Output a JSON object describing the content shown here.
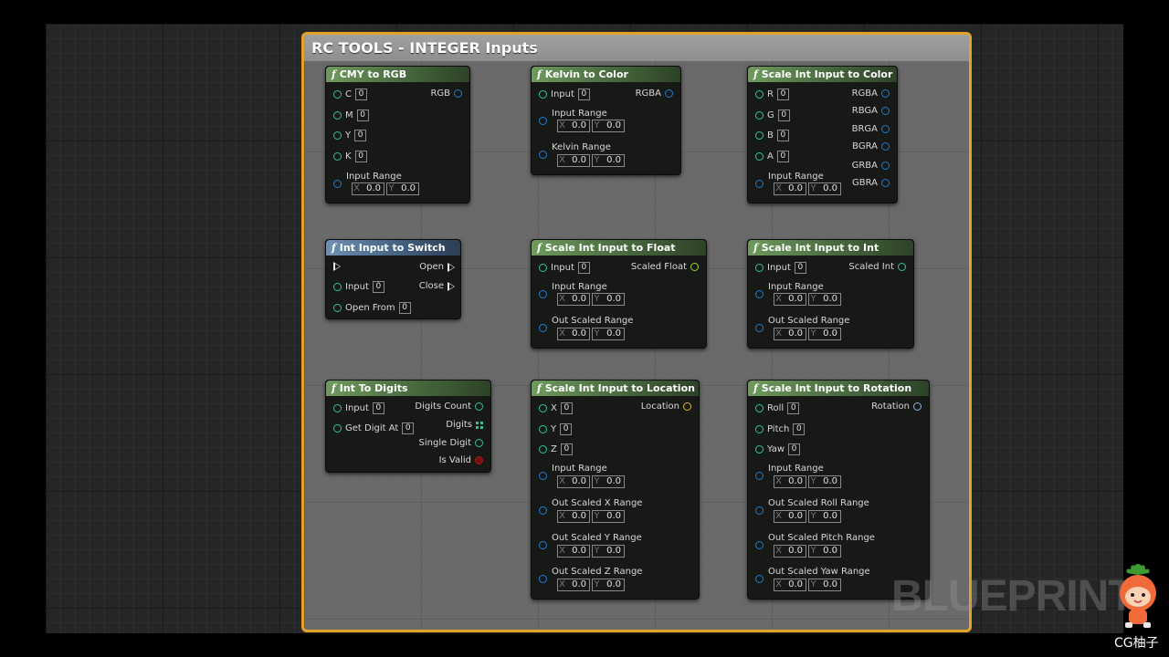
{
  "comment": {
    "title": "RC TOOLS - INTEGER Inputs"
  },
  "nodes": {
    "cmy": {
      "title": "CMY to RGB",
      "in": [
        "C",
        "M",
        "Y",
        "K"
      ],
      "in_values": [
        "0",
        "0",
        "0",
        "0"
      ],
      "range_label": "Input Range",
      "range_x": "0.0",
      "range_y": "0.0",
      "out": "RGB"
    },
    "kelvin": {
      "title": "Kelvin to Color",
      "in": "Input",
      "in_value": "0",
      "range1": "Input Range",
      "range1_x": "0.0",
      "range1_y": "0.0",
      "range2": "Kelvin Range",
      "range2_x": "0.0",
      "range2_y": "0.0",
      "out": "RGBA"
    },
    "scolor": {
      "title": "Scale Int Input to Color",
      "in": [
        "R",
        "G",
        "B",
        "A"
      ],
      "in_values": [
        "0",
        "0",
        "0",
        "0"
      ],
      "range_label": "Input Range",
      "range_x": "0.0",
      "range_y": "0.0",
      "out": [
        "RGBA",
        "RBGA",
        "BRGA",
        "BGRA",
        "GRBA",
        "GBRA"
      ]
    },
    "switch": {
      "title": "Int Input to Switch",
      "in": [
        "Input",
        "Open From"
      ],
      "in_values": [
        "0",
        "0"
      ],
      "out": [
        "Open",
        "Close"
      ]
    },
    "sfloat": {
      "title": "Scale Int Input to Float",
      "in": "Input",
      "in_value": "0",
      "range1": "Input Range",
      "range1_x": "0.0",
      "range1_y": "0.0",
      "range2": "Out Scaled Range",
      "range2_x": "0.0",
      "range2_y": "0.0",
      "out": "Scaled Float"
    },
    "sint": {
      "title": "Scale Int Input to Int",
      "in": "Input",
      "in_value": "0",
      "range1": "Input Range",
      "range1_x": "0.0",
      "range1_y": "0.0",
      "range2": "Out Scaled Range",
      "range2_x": "0.0",
      "range2_y": "0.0",
      "out": "Scaled Int"
    },
    "digits": {
      "title": "Int To Digits",
      "in": [
        "Input",
        "Get Digit At"
      ],
      "in_values": [
        "0",
        "0"
      ],
      "out": [
        "Digits Count",
        "Digits",
        "Single Digit",
        "Is Valid"
      ]
    },
    "sloc": {
      "title": "Scale Int Input to Location",
      "in": [
        "X",
        "Y",
        "Z"
      ],
      "in_values": [
        "0",
        "0",
        "0"
      ],
      "ranges": [
        "Input Range",
        "Out Scaled X Range",
        "Out Scaled Y Range",
        "Out Scaled Z Range"
      ],
      "range_x": "0.0",
      "range_y": "0.0",
      "out": "Location"
    },
    "srot": {
      "title": "Scale Int Input to Rotation",
      "in": [
        "Roll",
        "Pitch",
        "Yaw"
      ],
      "in_values": [
        "0",
        "0",
        "0"
      ],
      "ranges": [
        "Input Range",
        "Out Scaled Roll Range",
        "Out Scaled Pitch Range",
        "Out Scaled Yaw Range"
      ],
      "range_x": "0.0",
      "range_y": "0.0",
      "out": "Rotation"
    }
  },
  "axis": {
    "x": "X",
    "y": "Y"
  },
  "function_glyph": "f",
  "watermark": "BLUEPRINT",
  "brand": "CG柚子",
  "colors": {
    "comment_border": "#e3a32a",
    "int_pin": "#2fc29b",
    "struct_pin": "#1f7bd0",
    "vector_pin": "#e0b42a",
    "float_pin": "#9ad02c",
    "bool_pin": "#a31818"
  }
}
